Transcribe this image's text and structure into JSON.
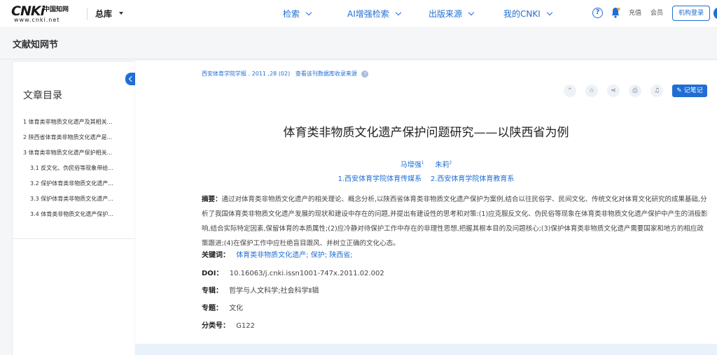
{
  "header": {
    "logo_text": "CNKi",
    "logo_cn": "中国知网",
    "logo_url": "www.cnki.net",
    "library_label": "总库",
    "nav": [
      {
        "label": "检索"
      },
      {
        "label": "AI增强检索"
      },
      {
        "label": "出版来源"
      },
      {
        "label": "我的CNKI"
      }
    ],
    "recharge_label": "充值",
    "member_label": "会员",
    "login_label": "机构登录"
  },
  "page": {
    "section_title": "文献知网节"
  },
  "toc": {
    "title": "文章目录",
    "items": [
      {
        "label": "1 体育类非物质文化遗产及其相关..."
      },
      {
        "label": "2 陕西省体育类非物质文化遗产是..."
      },
      {
        "label": "3 体育类非物质文化遗产保护相关..."
      },
      {
        "label": "3.1 反文化、伪民俗等现象带给..."
      },
      {
        "label": "3.2 保护体育类非物质文化遗产..."
      },
      {
        "label": "3.3 保护体育类非物质文化遗产..."
      },
      {
        "label": "3.4 体育类非物质文化遗产保护..."
      }
    ]
  },
  "article": {
    "source": "西安体育学院学报 . 2011 ,28 (02)",
    "source_note": "查看该刊数据库收录来源",
    "note_button": "记笔记",
    "title": "体育类非物质文化遗产保护问题研究——以陕西省为例",
    "authors": [
      {
        "name": "马增强",
        "sup": "1"
      },
      {
        "name": "朱莉",
        "sup": "2"
      }
    ],
    "affiliations": "1.西安体育学院体育传媒系    2.西安体育学院体育教育系",
    "abstract_label": "摘要：",
    "abstract": "通过对体育类非物质文化遗产的相关理论、概念分析,以陕西省体育类非物质文化遗产保护为案例,结合以往民俗学、民间文化、传统文化对体育文化研究的成果基础,分析了我国体育类非物质文化遗产发展的现状和建设中存在的问题,并提出有建设性的思考和对策:(1)应克服反文化、伪民俗等现象在体育类非物质文化遗产保护中产生的消极影响,结合实际特定因素,保留体育的本质属性;(2)应冷静对待保护工作中存在的非理性思想,把握其根本目的及问题核心;(3)保护体育类非物质文化遗产需要国家和地方的相应政策跟进;(4)在保护工作中应杜绝盲目跟风、并树立正确的文化心态。",
    "keywords_label": "关键词：",
    "keywords": [
      "体育类非物质文化遗产;",
      "保护;",
      "陕西省;"
    ],
    "doi_label": "DOI：",
    "doi": "10.16063/j.cnki.issn1001-747x.2011.02.002",
    "series_label": "专辑：",
    "series": "哲学与人文科学;社会科学Ⅱ辑",
    "topic_label": "专题：",
    "topic": "文化",
    "class_label": "分类号：",
    "class_no": "G122"
  },
  "colors": {
    "accent": "#1f6ed4"
  }
}
